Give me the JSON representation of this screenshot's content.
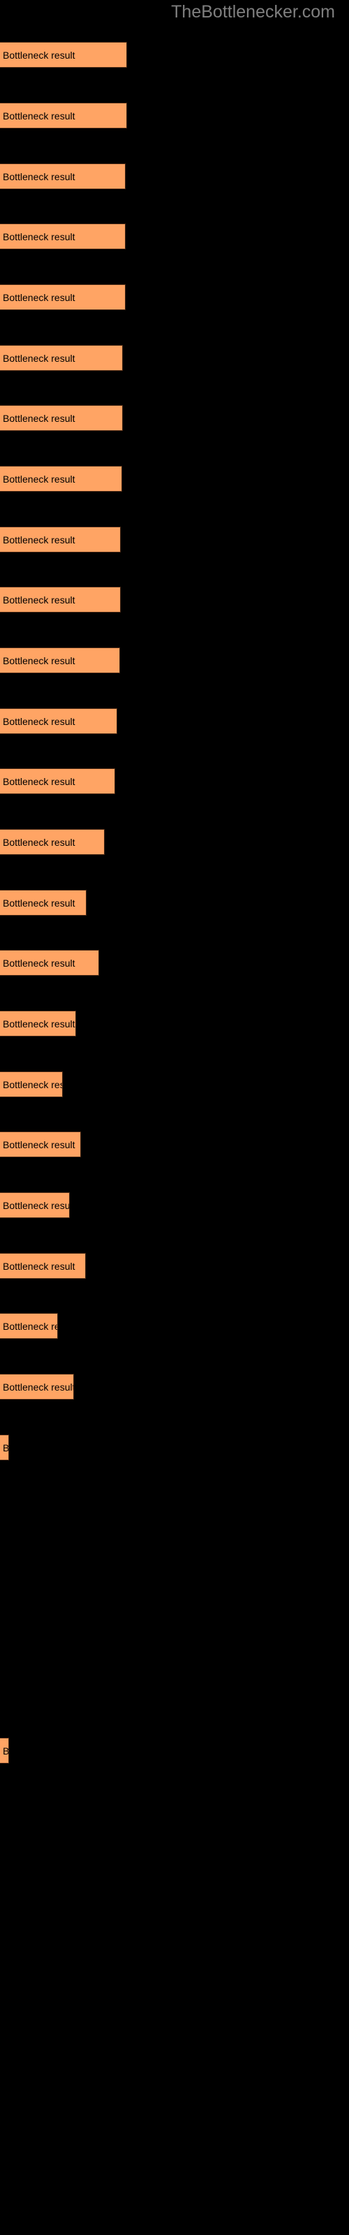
{
  "site": {
    "title": "TheBottlenecker.com",
    "title_color": "#7f7f7f"
  },
  "colors": {
    "background": "#000000",
    "bar_fill": "#ffa464",
    "bar_border": "#4a2a16",
    "label_text": "#000000"
  },
  "chart_data": {
    "type": "bar",
    "orientation": "horizontal",
    "title": "",
    "subtitle": "",
    "xlabel": "",
    "ylabel": "",
    "grid": false,
    "legend_position": "none",
    "bar_label_text": "Bottleneck result",
    "xlim": [
      0,
      500
    ],
    "categories": [
      "Bottleneck result",
      "Bottleneck result",
      "Bottleneck result",
      "Bottleneck result",
      "Bottleneck result",
      "Bottleneck result",
      "Bottleneck result",
      "Bottleneck result",
      "Bottleneck result",
      "Bottleneck result",
      "Bottleneck result",
      "Bottleneck result",
      "Bottleneck result",
      "Bottleneck result",
      "Bottleneck result",
      "Bottleneck result",
      "Bottleneck result",
      "Bottleneck result",
      "Bottleneck result",
      "Bottleneck result",
      "Bottleneck result",
      "Bottleneck result",
      "Bottleneck result",
      "Bottleneck result",
      "Bottleneck result",
      "Bottleneck result"
    ],
    "values": [
      182,
      182,
      180,
      180,
      180,
      176,
      176,
      175,
      173,
      173,
      172,
      168,
      165,
      150,
      124,
      142,
      109,
      90,
      116,
      100,
      123,
      83,
      106,
      13,
      13
    ],
    "bars": [
      {
        "index": 1,
        "label": "Bottleneck result",
        "width": 182,
        "top": 60,
        "value": 182
      },
      {
        "index": 2,
        "label": "Bottleneck result",
        "width": 182,
        "top": 147,
        "value": 182
      },
      {
        "index": 3,
        "label": "Bottleneck result",
        "width": 180,
        "top": 234,
        "value": 180
      },
      {
        "index": 4,
        "label": "Bottleneck result",
        "width": 180,
        "top": 320,
        "value": 180
      },
      {
        "index": 5,
        "label": "Bottleneck result",
        "width": 180,
        "top": 407,
        "value": 180
      },
      {
        "index": 6,
        "label": "Bottleneck result",
        "width": 176,
        "top": 494,
        "value": 176
      },
      {
        "index": 7,
        "label": "Bottleneck result",
        "width": 176,
        "top": 580,
        "value": 176
      },
      {
        "index": 8,
        "label": "Bottleneck result",
        "width": 175,
        "top": 667,
        "value": 175
      },
      {
        "index": 9,
        "label": "Bottleneck result",
        "width": 173,
        "top": 754,
        "value": 173
      },
      {
        "index": 10,
        "label": "Bottleneck result",
        "width": 173,
        "top": 840,
        "value": 173
      },
      {
        "index": 11,
        "label": "Bottleneck result",
        "width": 172,
        "top": 927,
        "value": 172
      },
      {
        "index": 12,
        "label": "Bottleneck result",
        "width": 168,
        "top": 1014,
        "value": 168
      },
      {
        "index": 13,
        "label": "Bottleneck result",
        "width": 165,
        "top": 1100,
        "value": 165
      },
      {
        "index": 14,
        "label": "Bottleneck result",
        "width": 150,
        "top": 1187,
        "value": 150
      },
      {
        "index": 15,
        "label": "Bottleneck result",
        "width": 124,
        "top": 1274,
        "value": 124
      },
      {
        "index": 16,
        "label": "Bottleneck result",
        "width": 142,
        "top": 1360,
        "value": 142
      },
      {
        "index": 17,
        "label": "Bottleneck result",
        "width": 109,
        "top": 1447,
        "value": 109
      },
      {
        "index": 18,
        "label": "Bottleneck result",
        "width": 90,
        "top": 1534,
        "value": 90
      },
      {
        "index": 19,
        "label": "Bottleneck result",
        "width": 116,
        "top": 1620,
        "value": 116
      },
      {
        "index": 20,
        "label": "Bottleneck result",
        "width": 100,
        "top": 1707,
        "value": 100
      },
      {
        "index": 21,
        "label": "Bottleneck result",
        "width": 123,
        "top": 1794,
        "value": 123
      },
      {
        "index": 22,
        "label": "Bottleneck result",
        "width": 83,
        "top": 1880,
        "value": 83
      },
      {
        "index": 23,
        "label": "Bottleneck result",
        "width": 106,
        "top": 1967,
        "value": 106
      },
      {
        "index": 24,
        "label": "Bottleneck result",
        "width": 13,
        "top": 2054,
        "value": 13
      },
      {
        "index": 25,
        "label": "Bottleneck result",
        "width": 13,
        "top": 2488,
        "value": 13
      }
    ]
  }
}
